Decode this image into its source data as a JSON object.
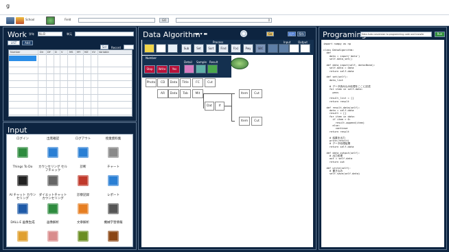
{
  "titlebar": {
    "title": "g"
  },
  "toolbar": {
    "school_label": "School",
    "field_label": "Field",
    "go_label": "GO",
    "combo_value": ""
  },
  "work": {
    "title": "Work",
    "grade_label": "学年",
    "grade_value": "Ko.B",
    "unit_label": "単元",
    "btn_list": "LIST",
    "btn_add": "Add",
    "btn_set": "Set",
    "record_label": "Record",
    "record_value": "",
    "columns": [
      "Number",
      "Dir",
      "DY",
      "D",
      "V",
      "MS",
      "MY",
      "MZ",
      "VV",
      "Variable"
    ]
  },
  "input": {
    "title": "Input",
    "items": [
      {
        "label": "ログイン",
        "icon": "exit-door-icon",
        "color": "#2e8b3e"
      },
      {
        "label": "出席確認",
        "icon": "calendar-icon",
        "color": "#2a7fd4"
      },
      {
        "label": "ログアウト",
        "icon": "logout-icon",
        "color": "#2a7fd4"
      },
      {
        "label": "授業資料集",
        "icon": "document-icon",
        "color": "#8a8a8a"
      },
      {
        "label": "Things To Do",
        "icon": "runner-icon",
        "color": "#222222"
      },
      {
        "label": "カウンセリング セルフチェック",
        "icon": "clipboard-icon",
        "color": "#666666"
      },
      {
        "label": "診断",
        "icon": "checklist-icon",
        "color": "#c0392b"
      },
      {
        "label": "チャート",
        "icon": "compass-chart-icon",
        "color": "#2a7fd4"
      },
      {
        "label": "AI チャット カウンセリング",
        "icon": "ai-chat-icon",
        "color": "#1e5aa8"
      },
      {
        "label": "ダイエットチャット カウンセリング",
        "icon": "chat-bubbles-icon",
        "color": "#2e8b3e"
      },
      {
        "label": "診察記録",
        "icon": "record-book-icon",
        "color": "#e67e22"
      },
      {
        "label": "レポート",
        "icon": "report-icon",
        "color": "#555555"
      },
      {
        "label": "DALL-E 画像生成",
        "icon": "landscape-image-icon",
        "color": "#e0a030"
      },
      {
        "label": "画像解析",
        "icon": "portrait-icon",
        "color": "#d98c8c"
      },
      {
        "label": "文章解析",
        "icon": "books-icon",
        "color": "#6b8e23"
      },
      {
        "label": "機械学習情報",
        "icon": "book-stack-icon",
        "color": "#8b4513"
      }
    ]
  },
  "algo": {
    "title": "Data Algorithm",
    "btn_a": "Go",
    "btn_b": "出力",
    "btn_c": "保存",
    "tab_input": "Input",
    "tab_output": "Output",
    "tab_process": "Process",
    "tools": [
      "Sub",
      "Set",
      "Sort",
      "Find",
      "F(x)",
      "Pwy",
      "SBC"
    ],
    "row2_label": "Number",
    "row2_btns": [
      "Stop",
      "Write",
      "Yes"
    ],
    "row3_labels": [
      "Detail",
      "Sample",
      "Result"
    ],
    "flow_top": [
      "Photo",
      "CD",
      "Data",
      "Title",
      "FC",
      "Cut"
    ],
    "flow_a": [
      "AR",
      "Data",
      "Tab",
      "Mit"
    ],
    "flow_b": [
      "Dat",
      "If"
    ],
    "flow_c": [
      "Item",
      "Cut"
    ],
    "flow_d": [
      "Item",
      "Cut"
    ]
  },
  "prog": {
    "title": "Programing",
    "banner": "Data Auto conversion to programming code and transfer",
    "btn_run": "Run",
    "code": "import numpy as np\n\nclass DataAlgorithm:\n  def\n    data = input('data')\n    self.data_set()\n\n  def data_input(self, data=None):\n    self.data = data\n    return self.data\n\n  def set(self):\n    data_list\n\n    # データ読み込み処理をここに記述\n    for item in self.data:\n      pass\n\n    result_list = []\n    return result\n\n  def result_data(self):\n    data = self.data\n    result = []\n    for item in data:\n      if item > 0:\n        result.append(item)\n      else:\n        continue\n    return result\n\n    # 結果を出力\n    print(result)\n    # データ処理結果\n    return self.data\n\n  def data_output(self):\n    # 出力処理\n    out = self.data\n    return out\n\n  def write(self):\n    # 書き込み\n    self.save(self.data)"
  }
}
